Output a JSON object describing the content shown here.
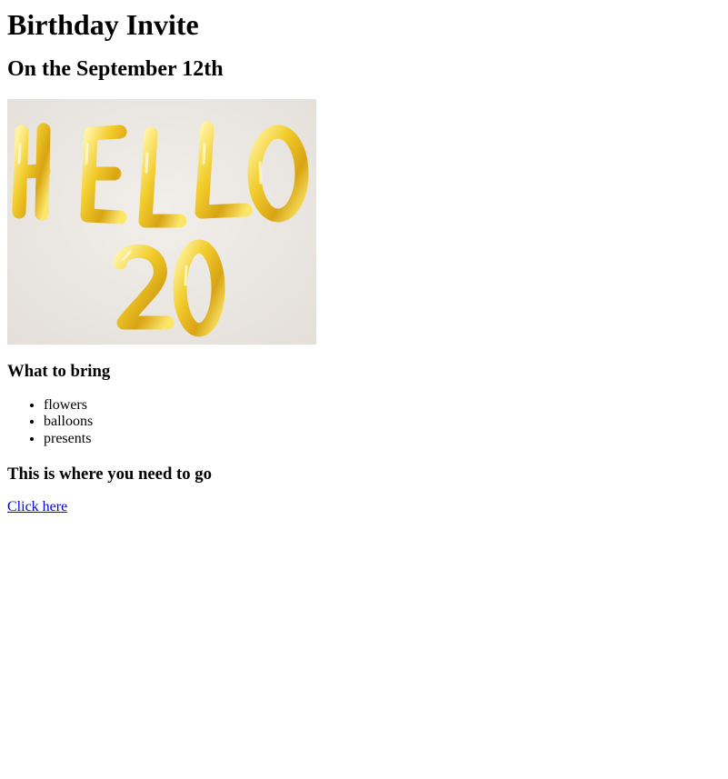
{
  "page": {
    "title": "Birthday Invite",
    "date_heading": "On the September 12th",
    "image": {
      "balloon_text_top": "HELLO",
      "balloon_text_bottom": "20",
      "balloon_color": "#e0b81e",
      "background_color": "#ebe6e1"
    },
    "bring_heading": "What to bring",
    "bring_items": [
      "flowers",
      "balloons",
      "presents"
    ],
    "where_heading": "This is where you need to go",
    "link_text": "Click here",
    "link_color": "#0000ee"
  }
}
